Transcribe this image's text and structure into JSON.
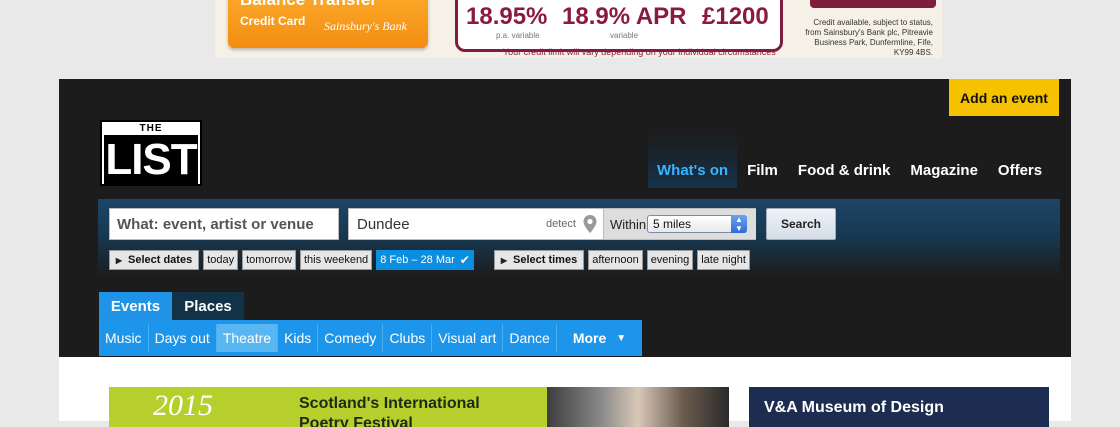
{
  "ad": {
    "headline": "Balance Transfer",
    "product": "Credit Card",
    "brand": "Sainsbury's Bank",
    "rate1": "18.95%",
    "rate1_sub": "p.a. variable",
    "rate2": "18.9% APR",
    "rate2_sub": "variable",
    "limit": "£1200",
    "note": "Your credit limit will vary depending on your individual circumstances",
    "fine_print": "Credit available, subject to status, from Sainsbury's Bank plc, Pitreavie Business Park, Dunfermline, Fife, KY99 4BS."
  },
  "header": {
    "add_event": "Add an event",
    "logo_the": "THE",
    "logo_list": "LIST",
    "nav": [
      {
        "label": "What's on"
      },
      {
        "label": "Film"
      },
      {
        "label": "Food & drink"
      },
      {
        "label": "Magazine"
      },
      {
        "label": "Offers"
      }
    ]
  },
  "search": {
    "what_placeholder": "What: event, artist or venue",
    "where_value": "Dundee",
    "detect_label": "detect",
    "within_label": "Within",
    "within_value": "5 miles",
    "search_button": "Search"
  },
  "dates": {
    "toggle_label": "Select dates",
    "options": [
      "today",
      "tomorrow",
      "this weekend"
    ],
    "selected": "8 Feb – 28 Mar"
  },
  "times": {
    "toggle_label": "Select times",
    "options": [
      "afternoon",
      "evening",
      "late night"
    ]
  },
  "tabs": {
    "events": "Events",
    "places": "Places"
  },
  "categories": [
    "Music",
    "Days out",
    "Theatre",
    "Kids",
    "Comedy",
    "Clubs",
    "Visual art",
    "Dance"
  ],
  "more_label": "More",
  "promo": {
    "year": "2015",
    "title_line1": "Scotland's International",
    "title_line2": "Poetry Festival",
    "right_title": "V&A Museum of Design"
  },
  "colors": {
    "header_bg": "#1c1c1c",
    "accent_blue": "#1d95ea",
    "add_event_yellow": "#f6c200",
    "nav_active": "#3db3ff"
  }
}
